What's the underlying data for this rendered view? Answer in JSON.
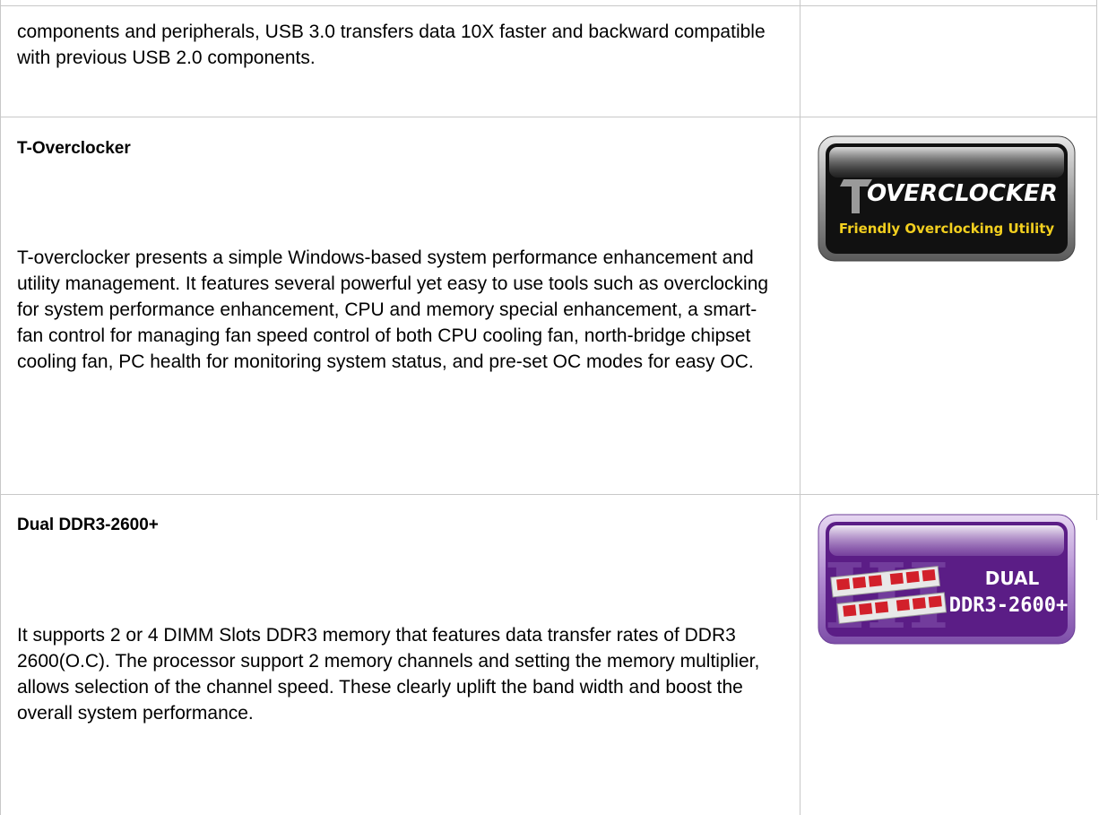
{
  "rows": [
    {
      "title": "",
      "text": "components and peripherals, USB 3.0 transfers data 10X faster and backward compatible with previous USB 2.0 components."
    },
    {
      "title": "T-Overclocker",
      "text": "T-overclocker presents a simple Windows-based system performance enhancement and utility management. It features several powerful yet easy to use tools such as overclocking for system performance enhancement, CPU and memory special enhancement, a smart-fan control for managing fan speed control of both CPU cooling fan, north-bridge chipset cooling fan, PC health for monitoring system status, and pre-set OC modes for easy OC.",
      "badge": {
        "icon": "overclocker-logo",
        "line1": "OVERCLOCKER",
        "line2": "Friendly Overclocking Utility",
        "colors": {
          "frame": "#9a9a9a",
          "body": "#111111",
          "accent": "#f2cf1f"
        }
      }
    },
    {
      "title": "Dual DDR3-2600+",
      "text": "It supports 2 or 4 DIMM Slots DDR3 memory that features data transfer rates of DDR3 2600(O.C). The processor support 2 memory channels and setting the memory multiplier, allows selection of the channel speed. These clearly uplift the band width and boost the overall system performance.",
      "badge": {
        "icon": "ddr3-memory-logo",
        "line1": "DUAL",
        "line2": "DDR3-2600+",
        "colors": {
          "frame": "#b08ad0",
          "body": "#5b1d86",
          "accent": "#d2202a"
        }
      }
    }
  ]
}
